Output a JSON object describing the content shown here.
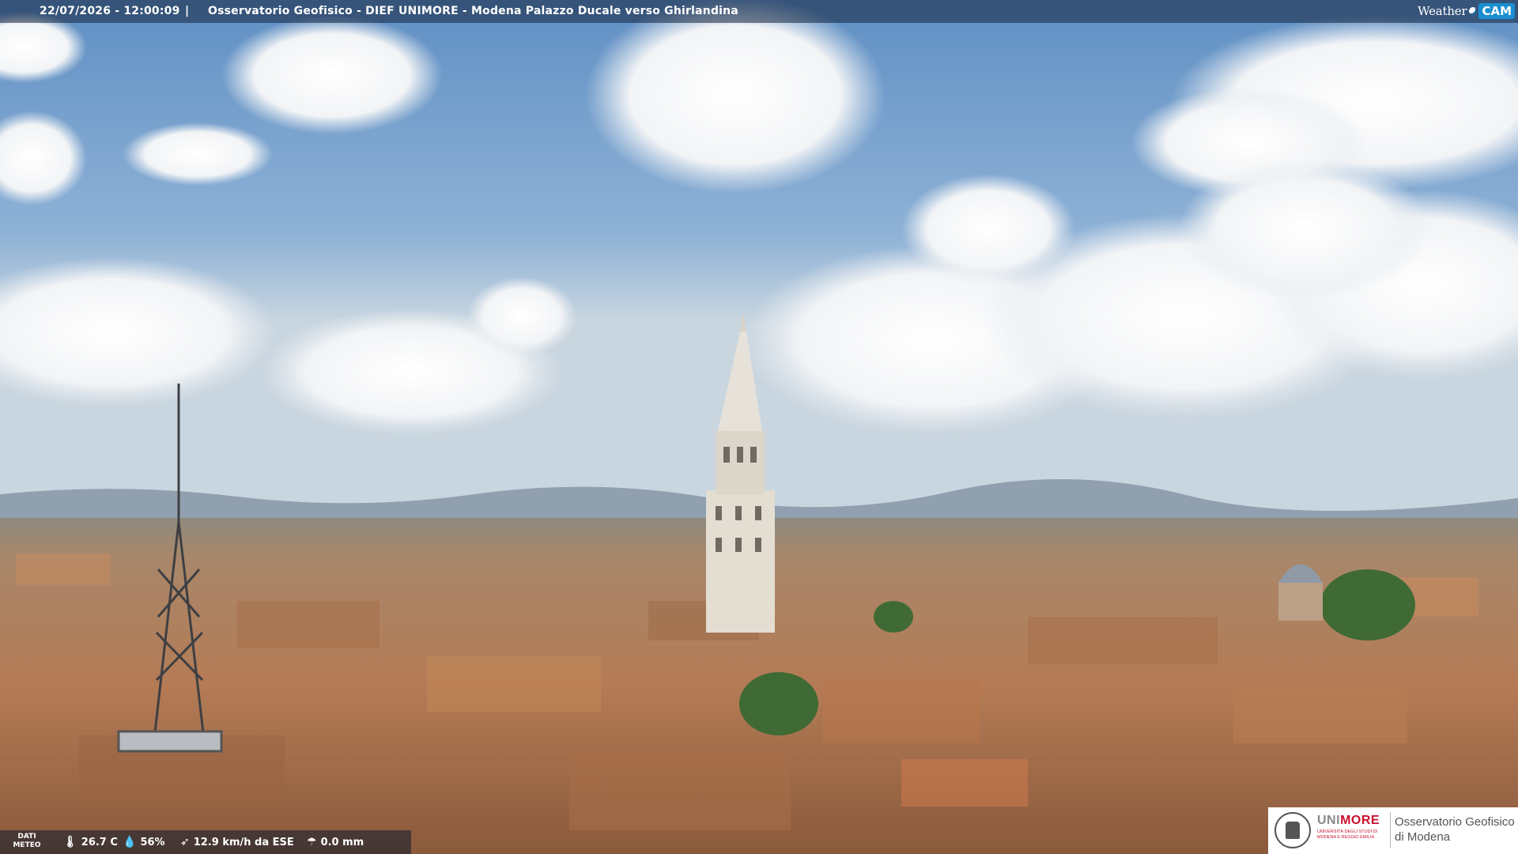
{
  "header": {
    "timestamp": "22/07/2026 - 12:00:09",
    "separator": "|",
    "title": "Osservatorio Geofisico - DIEF UNIMORE - Modena Palazzo Ducale verso Ghirlandina"
  },
  "brand": {
    "left": "Weather",
    "right": "CAM"
  },
  "meteo": {
    "label_line1": "DATI",
    "label_line2": "METEO",
    "temperature": "26.7 C",
    "humidity": "56%",
    "wind": "12.9 km/h da ESE",
    "rain": "0.0 mm",
    "icons": [
      "thermometer-icon",
      "humidity-drop-icon",
      "wind-icon",
      "rain-icon"
    ]
  },
  "logo": {
    "uni_a": "UNI",
    "uni_b": "MORE",
    "uni_sub": "UNIVERSITÀ DEGLI STUDI DI MODENA E REGGIO EMILIA",
    "obs_line1": "Osservatorio Geofisico",
    "obs_line2": "di Modena"
  },
  "colors": {
    "sky": "#7ea6cf",
    "roofs": "#b07a55",
    "accent_red": "#c8102e",
    "cam_blue": "#1a8fd0"
  }
}
